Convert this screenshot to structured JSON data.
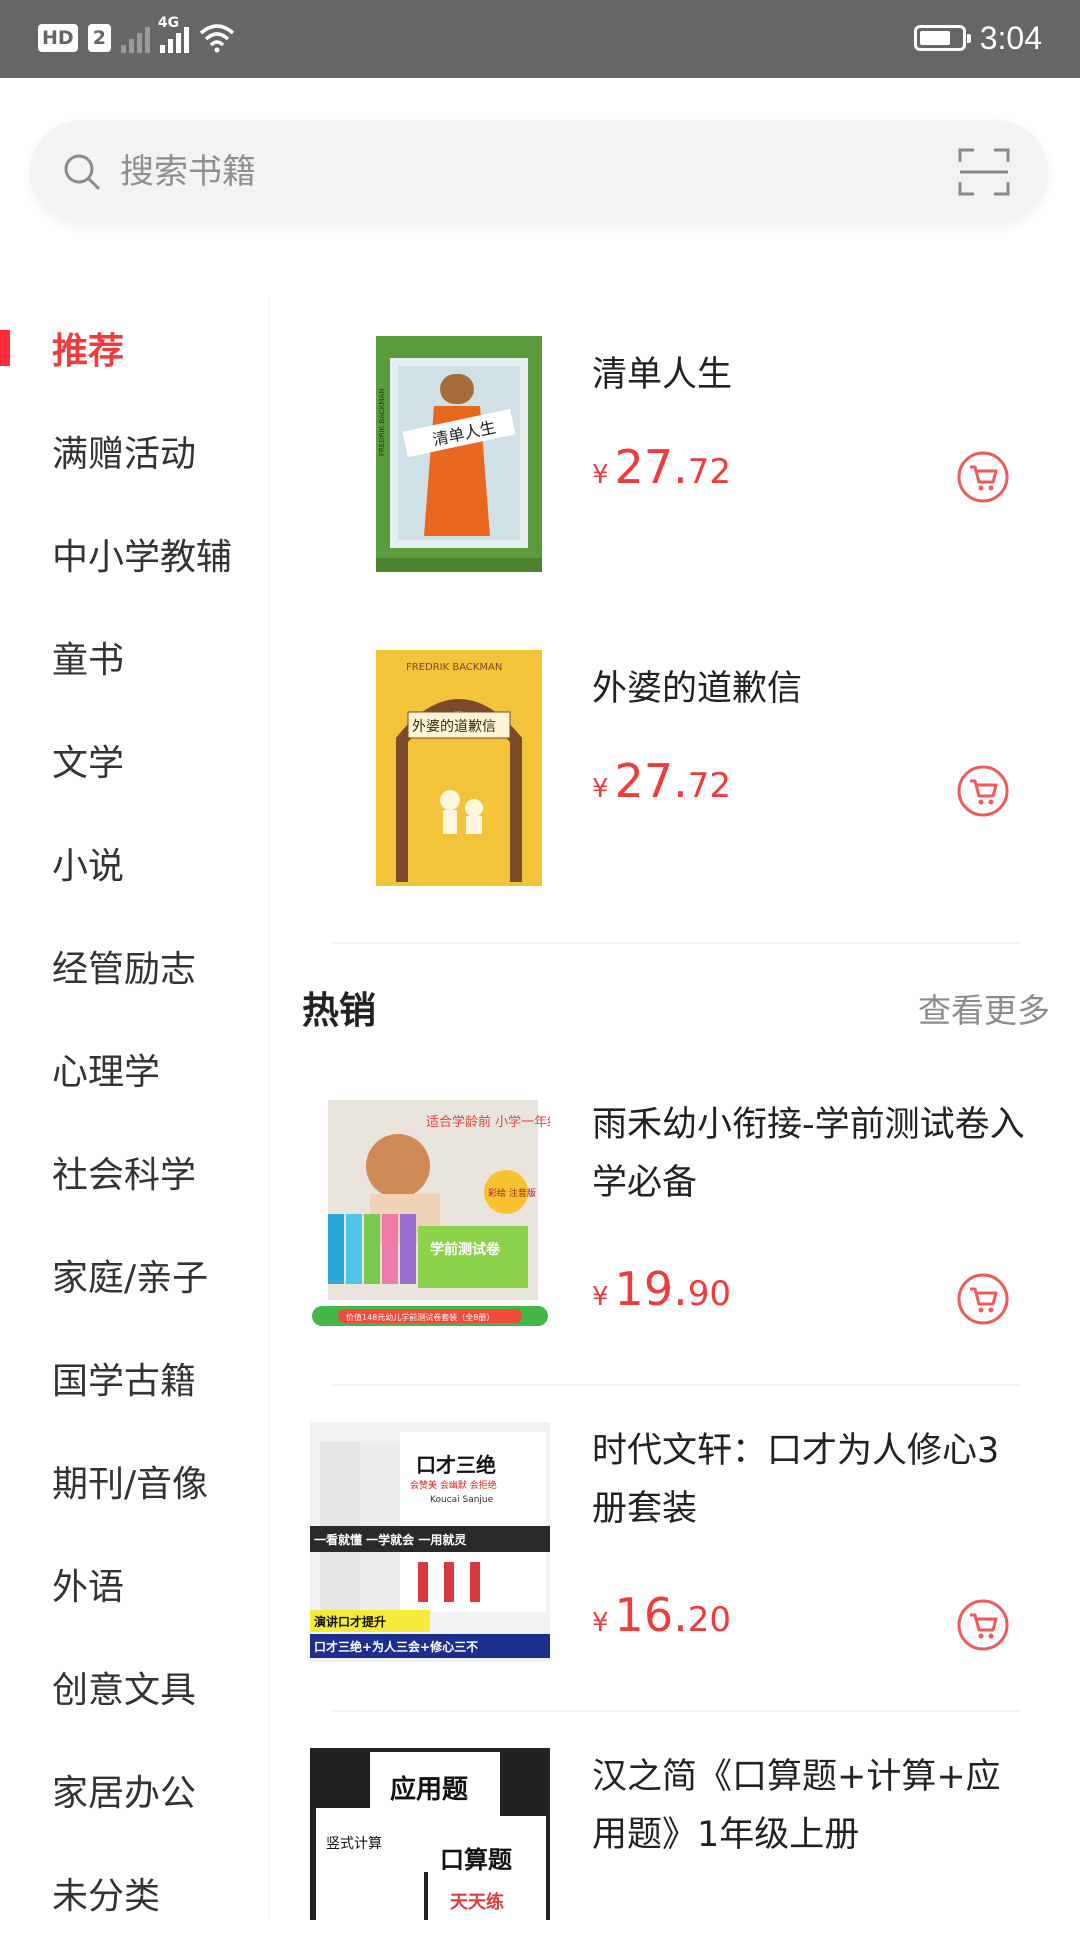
{
  "status_bar": {
    "hd": "HD",
    "sim": "2",
    "network": "4G",
    "time": "3:04"
  },
  "search": {
    "placeholder": "搜索书籍"
  },
  "categories": [
    {
      "label": "推荐",
      "active": true
    },
    {
      "label": "满赠活动"
    },
    {
      "label": "中小学教辅"
    },
    {
      "label": "童书"
    },
    {
      "label": "文学"
    },
    {
      "label": "小说"
    },
    {
      "label": "经管励志"
    },
    {
      "label": "心理学"
    },
    {
      "label": "社会科学"
    },
    {
      "label": "家庭/亲子"
    },
    {
      "label": "国学古籍"
    },
    {
      "label": "期刊/音像"
    },
    {
      "label": "外语"
    },
    {
      "label": "创意文具"
    },
    {
      "label": "家居办公"
    },
    {
      "label": "未分类"
    }
  ],
  "recommended": [
    {
      "title": "清单人生",
      "price_yen": "¥",
      "price_int": "27.",
      "price_dec": "72",
      "cover": {
        "en": "FREDRIK BACKMAN",
        "zh": "清单人生",
        "color": "#5b9a3d"
      }
    },
    {
      "title": "外婆的道歉信",
      "price_yen": "¥",
      "price_int": "27.",
      "price_dec": "72",
      "cover": {
        "en": "FREDRIK BACKMAN",
        "zh": "外婆的道歉信",
        "color": "#f3c33a"
      }
    }
  ],
  "hot_section": {
    "title": "热销",
    "more": "查看更多"
  },
  "hot": [
    {
      "title": "雨禾幼小衔接-学前测试卷入学必备",
      "price_yen": "¥",
      "price_int": "19.",
      "price_dec": "90",
      "cover": {
        "top": "适合学龄前 小学一年级儿童",
        "badge": "彩绘 注音版",
        "main": "学前测试卷",
        "bottom": "价值148元幼儿学前测试卷套装（全8册）"
      }
    },
    {
      "title": "时代文轩：口才为人修心3册套装",
      "price_yen": "¥",
      "price_int": "16.",
      "price_dec": "20",
      "cover": {
        "main": "口才三绝",
        "sub": "会赞美 会幽默 会拒绝",
        "pinyin": "Koucai Sanjue",
        "bar": "一看就懂 一学就会 一用就灵",
        "tag": "演讲口才提升",
        "bottom": "口才三绝+为人三会+修心三不"
      }
    },
    {
      "title": "汉之简《口算题+计算+应用题》1年级上册",
      "cover": {
        "a": "应用题",
        "b": "竖式计算",
        "c": "口算题",
        "d": "天天练"
      }
    }
  ],
  "colors": {
    "accent": "#ef3b3b",
    "status_bar": "#666666",
    "search_bg": "#f3f3f3"
  }
}
